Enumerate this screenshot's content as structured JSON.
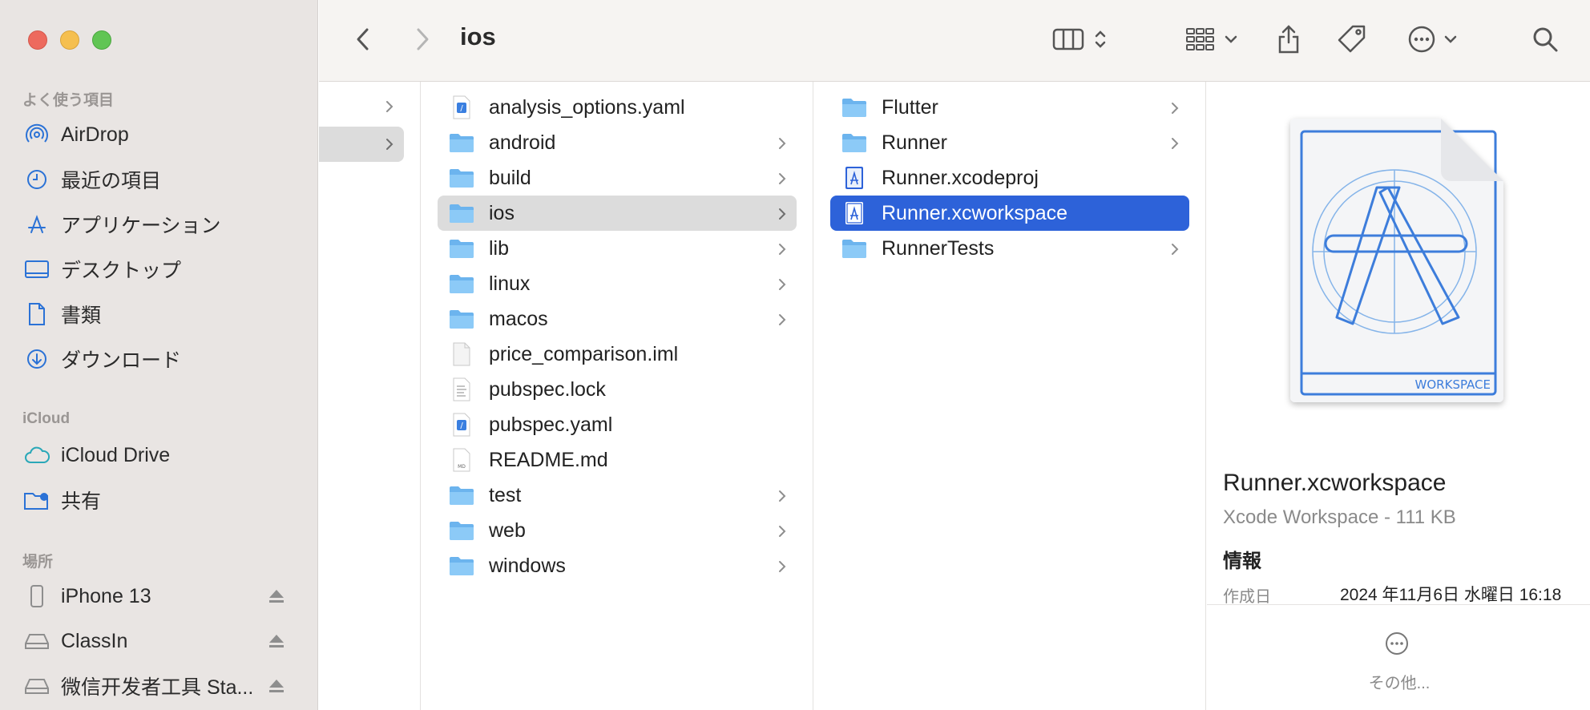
{
  "sidebar": {
    "favorites_title": "よく使う項目",
    "favorites": [
      {
        "label": "AirDrop",
        "icon": "airdrop-icon"
      },
      {
        "label": "最近の項目",
        "icon": "clock-icon"
      },
      {
        "label": "アプリケーション",
        "icon": "applications-icon"
      },
      {
        "label": "デスクトップ",
        "icon": "desktop-icon"
      },
      {
        "label": "書類",
        "icon": "document-icon"
      },
      {
        "label": "ダウンロード",
        "icon": "download-icon"
      }
    ],
    "icloud_title": "iCloud",
    "icloud": [
      {
        "label": "iCloud Drive",
        "icon": "cloud-icon"
      },
      {
        "label": "共有",
        "icon": "shared-folder-icon"
      }
    ],
    "locations_title": "場所",
    "locations": [
      {
        "label": "iPhone 13",
        "icon": "iphone-icon"
      },
      {
        "label": "ClassIn",
        "icon": "drive-icon"
      },
      {
        "label": "微信开发者工具 Sta...",
        "icon": "drive-icon"
      }
    ]
  },
  "toolbar": {
    "title": "ios"
  },
  "column1": [
    {
      "label": "analysis_options.yaml",
      "type": "yaml",
      "folder": false
    },
    {
      "label": "android",
      "type": "folder",
      "folder": true
    },
    {
      "label": "build",
      "type": "folder",
      "folder": true
    },
    {
      "label": "ios",
      "type": "folder",
      "folder": true,
      "selected": true
    },
    {
      "label": "lib",
      "type": "folder",
      "folder": true
    },
    {
      "label": "linux",
      "type": "folder",
      "folder": true
    },
    {
      "label": "macos",
      "type": "folder",
      "folder": true
    },
    {
      "label": "price_comparison.iml",
      "type": "file",
      "folder": false
    },
    {
      "label": "pubspec.lock",
      "type": "text",
      "folder": false
    },
    {
      "label": "pubspec.yaml",
      "type": "yaml",
      "folder": false
    },
    {
      "label": "README.md",
      "type": "md",
      "folder": false
    },
    {
      "label": "test",
      "type": "folder",
      "folder": true
    },
    {
      "label": "web",
      "type": "folder",
      "folder": true
    },
    {
      "label": "windows",
      "type": "folder",
      "folder": true
    }
  ],
  "column2": [
    {
      "label": "Flutter",
      "type": "folder",
      "folder": true
    },
    {
      "label": "Runner",
      "type": "folder",
      "folder": true
    },
    {
      "label": "Runner.xcodeproj",
      "type": "xcode",
      "folder": false
    },
    {
      "label": "Runner.xcworkspace",
      "type": "xcode",
      "folder": false,
      "selected": true
    },
    {
      "label": "RunnerTests",
      "type": "folder",
      "folder": true
    }
  ],
  "preview": {
    "icon_badge": "WORKSPACE",
    "name": "Runner.xcworkspace",
    "kind": "Xcode Workspace - 111 KB",
    "info_title": "情報",
    "created_label": "作成日",
    "created_value": "2024 年11月6日 水曜日 16:18",
    "more_label": "その他..."
  },
  "colors": {
    "selection_blue": "#2d62d9",
    "folder_blue": "#6cb4ee",
    "sidebar_accent": "#2b72d6"
  }
}
